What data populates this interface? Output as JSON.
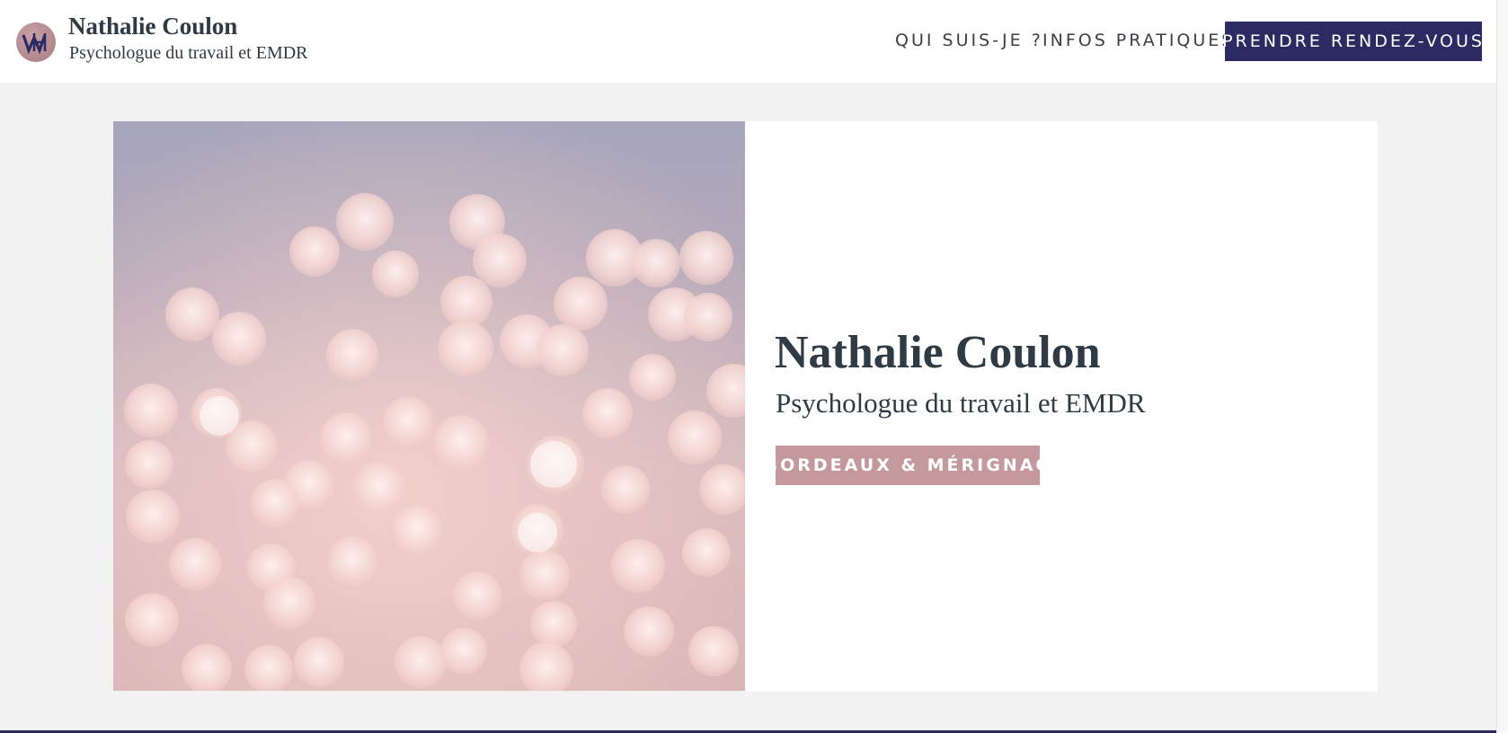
{
  "header": {
    "site_title": "Nathalie Coulon",
    "site_tagline": "Psychologue du travail et EMDR",
    "logo_icon": "monogram-logo-icon"
  },
  "nav": {
    "items": [
      {
        "label": "QUI SUIS-JE ?"
      },
      {
        "label": "INFOS PRATIQUES"
      }
    ],
    "cta_label": "PRENDRE RENDEZ-VOUS"
  },
  "hero": {
    "title": "Nathalie Coulon",
    "subtitle": "Psychologue du travail et EMDR",
    "location_badge": "BORDEAUX & MÉRIGNAC"
  },
  "colors": {
    "primary": "#2b2a63",
    "accent_pink": "#c5999c",
    "text_dark": "#2e3a44",
    "background": "#f2f2f2"
  }
}
